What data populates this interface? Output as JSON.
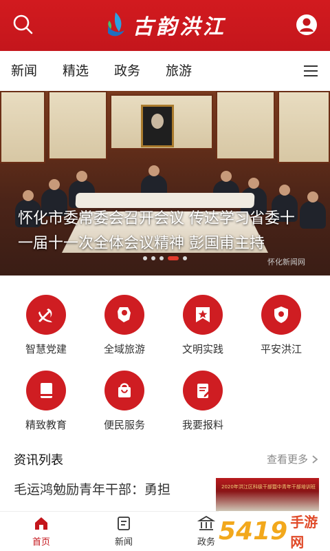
{
  "header": {
    "app_title": "古韵洪江",
    "search_icon": "search-icon",
    "user_icon": "user-icon"
  },
  "tabs": [
    {
      "label": "新闻"
    },
    {
      "label": "精选"
    },
    {
      "label": "政务"
    },
    {
      "label": "旅游"
    }
  ],
  "banner": {
    "caption": "怀化市委常委会召开会议 传达学习省委十一届十一次全体会议精神 彭国甫主持",
    "watermark": "怀化新闻网",
    "slide_count": 5,
    "active_slide": 3
  },
  "services": [
    {
      "label": "智慧党建",
      "icon": "party-emblem-icon"
    },
    {
      "label": "全域旅游",
      "icon": "map-pin-icon"
    },
    {
      "label": "文明实践",
      "icon": "flag-star-icon"
    },
    {
      "label": "平安洪江",
      "icon": "police-shield-icon"
    },
    {
      "label": "精致教育",
      "icon": "book-icon"
    },
    {
      "label": "便民服务",
      "icon": "shopping-bag-icon"
    },
    {
      "label": "我要报料",
      "icon": "edit-document-icon"
    }
  ],
  "news": {
    "section_title": "资讯列表",
    "more_label": "查看更多",
    "items": [
      {
        "title": "毛运鸿勉励青年干部：勇担",
        "thumb_text": "2020年洪江区科级干部暨中青年干部培训班"
      }
    ]
  },
  "bottom_nav": [
    {
      "label": "首页",
      "active": true
    },
    {
      "label": "新闻",
      "active": false
    },
    {
      "label": "政务",
      "active": false
    },
    {
      "label": "",
      "active": false
    }
  ],
  "corner_watermark": {
    "num": "5419",
    "site": "手游网"
  },
  "colors": {
    "brand_red": "#c4161c",
    "gray_text": "#888888"
  }
}
